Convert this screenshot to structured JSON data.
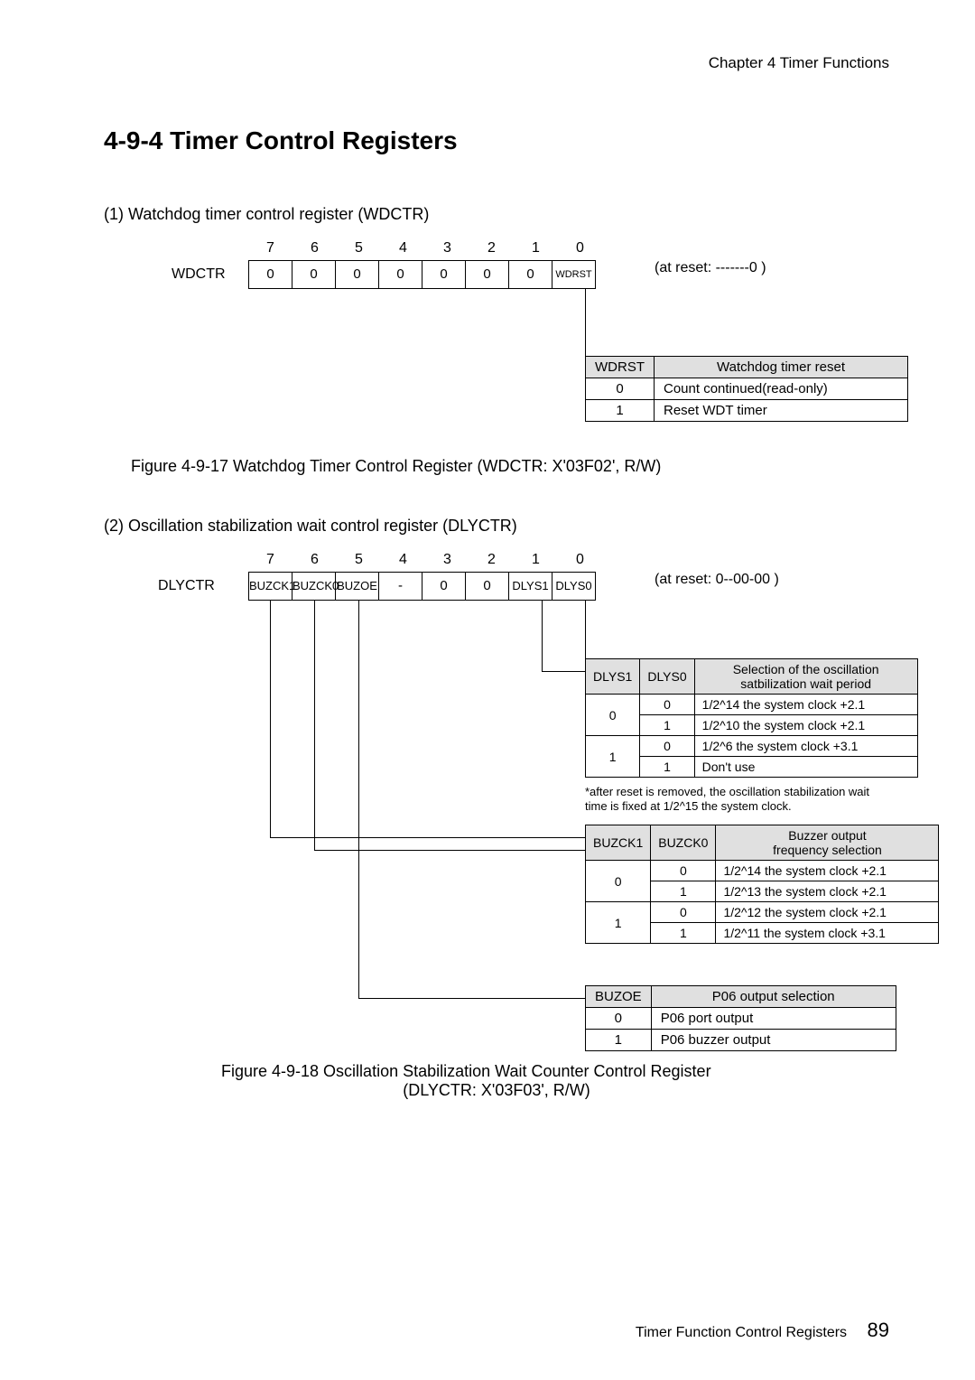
{
  "chapter": "Chapter 4  Timer Functions",
  "h1": "4-9-4  Timer Control Registers",
  "sec1": {
    "head": "(1) Watchdog timer control register (WDCTR)",
    "bits": [
      "7",
      "6",
      "5",
      "4",
      "3",
      "2",
      "1",
      "0"
    ],
    "label": "WDCTR",
    "cells": [
      "0",
      "0",
      "0",
      "0",
      "0",
      "0",
      "0",
      "WDRST"
    ],
    "reset": "(at reset: -------0 )",
    "t": {
      "h1": "WDRST",
      "h2": "Watchdog timer reset",
      "r1a": "0",
      "r1b": "Count continued(read-only)",
      "r2a": "1",
      "r2b": "Reset WDT timer"
    },
    "caption": "Figure 4-9-17  Watchdog Timer Control Register (WDCTR: X'03F02', R/W)"
  },
  "sec2": {
    "head": "(2) Oscillation stabilization wait control register (DLYCTR)",
    "bits": [
      "7",
      "6",
      "5",
      "4",
      "3",
      "2",
      "1",
      "0"
    ],
    "label": "DLYCTR",
    "cells": [
      "BUZCK1",
      "BUZCK0",
      "BUZOE",
      "-",
      "0",
      "0",
      "DLYS1",
      "DLYS0"
    ],
    "reset": "(at reset: 0--00-00 )",
    "tA": {
      "h1": "DLYS1",
      "h2": "DLYS0",
      "h3": "Selection of the oscillation\nsatbilization wait period",
      "r1": [
        "0",
        "0",
        "1/2^14 the system clock +2.1"
      ],
      "r2": [
        "0",
        "1",
        "1/2^10 the system clock +2.1"
      ],
      "r3": [
        "1",
        "0",
        "1/2^6 the system clock +3.1"
      ],
      "r4": [
        "1",
        "1",
        "Don't use"
      ],
      "note": "*after reset is removed, the oscillation stabilization wait time is fixed at 1/2^15 the system clock."
    },
    "tB": {
      "h1": "BUZCK1",
      "h2": "BUZCK0",
      "h3": "Buzzer output\nfrequency selection",
      "r1": [
        "0",
        "0",
        "1/2^14 the system clock +2.1"
      ],
      "r2": [
        "0",
        "1",
        "1/2^13 the system clock +2.1"
      ],
      "r3": [
        "1",
        "0",
        "1/2^12 the system clock +2.1"
      ],
      "r4": [
        "1",
        "1",
        "1/2^11 the system clock +3.1"
      ]
    },
    "tC": {
      "h1": "BUZOE",
      "h2": "P06 output selection",
      "r1": [
        "0",
        "P06 port output"
      ],
      "r2": [
        "1",
        "P06 buzzer output"
      ]
    },
    "caption1": "Figure 4-9-18  Oscillation Stabilization Wait Counter Control Register",
    "caption2": "(DLYCTR: X'03F03', R/W)"
  },
  "footer": {
    "label": "Timer Function Control Registers",
    "page": "89"
  }
}
